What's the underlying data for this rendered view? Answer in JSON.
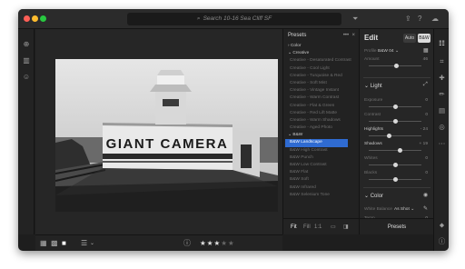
{
  "titlebar": {
    "search_placeholder": "Search 10-16 Sea Cliff SF",
    "search_icon": "search-icon",
    "filter_icon": "filter-icon",
    "share_icon": "share-icon",
    "help_icon": "help-icon",
    "cloud_icon": "cloud-sync-icon"
  },
  "photo_text": "GIANT CAMERA",
  "bottombar": {
    "rating": 3,
    "rating_max": 5
  },
  "presets": {
    "title": "Presets",
    "more": "•••",
    "close": "×",
    "rows": [
      {
        "label": "Color",
        "type": "group",
        "arrow": "›"
      },
      {
        "label": "Creative",
        "type": "group",
        "arrow": "⌄"
      },
      {
        "label": "Creative - Desaturated Contrast",
        "type": "item"
      },
      {
        "label": "Creative - Cool Light",
        "type": "item"
      },
      {
        "label": "Creative - Turquoise & Red",
        "type": "item"
      },
      {
        "label": "Creative - Soft Mist",
        "type": "item"
      },
      {
        "label": "Creative - Vintage Instant",
        "type": "item"
      },
      {
        "label": "Creative - Warm Contrast",
        "type": "item"
      },
      {
        "label": "Creative - Flat & Green",
        "type": "item"
      },
      {
        "label": "Creative - Red Lift Matte",
        "type": "item"
      },
      {
        "label": "Creative - Warm Shadows",
        "type": "item"
      },
      {
        "label": "Creative - Aged Photo",
        "type": "item"
      },
      {
        "label": "B&W",
        "type": "group",
        "arrow": "⌄"
      },
      {
        "label": "B&W Landscape",
        "type": "selected"
      },
      {
        "label": "B&W High Contrast",
        "type": "item"
      },
      {
        "label": "B&W Punch",
        "type": "item"
      },
      {
        "label": "B&W Low Contrast",
        "type": "item"
      },
      {
        "label": "B&W Flat",
        "type": "item"
      },
      {
        "label": "B&W Soft",
        "type": "item"
      },
      {
        "label": "B&W Infrared",
        "type": "item"
      },
      {
        "label": "B&W Selenium Tone",
        "type": "item"
      }
    ],
    "footer": {
      "fit": "Fit",
      "fill": "Fill",
      "ratio": "1:1"
    }
  },
  "edit": {
    "title": "Edit",
    "auto": "Auto",
    "bw": "B&W",
    "profile_label": "Profile",
    "profile_value": "B&W 04",
    "amount_label": "Amount",
    "amount_value": 46,
    "light_section": "Light",
    "light_rows": [
      {
        "label": "Exposure",
        "value": "0",
        "knob": 0.5
      },
      {
        "label": "Contrast",
        "value": "0",
        "knob": 0.5
      },
      {
        "label": "Highlights",
        "value": "- 24",
        "knob": 0.38,
        "bright": true
      },
      {
        "label": "Shadows",
        "value": "+ 19",
        "knob": 0.6,
        "bright": true
      },
      {
        "label": "Whites",
        "value": "0",
        "knob": 0.5
      },
      {
        "label": "Blacks",
        "value": "0",
        "knob": 0.5
      }
    ],
    "color_section": "Color",
    "white_balance_label": "White Balance",
    "white_balance_value": "As Shot",
    "temp_label": "Temp",
    "temp_value": "0",
    "footer": "Presets"
  },
  "colors": {
    "selection": "#2f6bd1",
    "close_light": "#ff5f57",
    "min_light": "#febc2e",
    "max_light": "#28c840"
  }
}
